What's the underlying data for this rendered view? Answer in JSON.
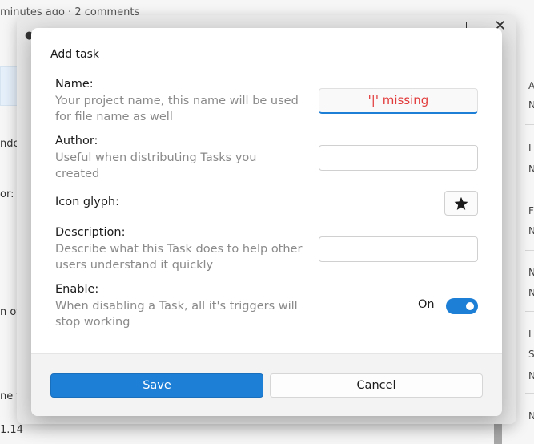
{
  "background": {
    "top_line": "minutes ago · 2 comments",
    "left_snippets": [
      "ndo",
      "or:",
      "n of",
      "ne f",
      "1.14"
    ],
    "right_letters": [
      "A",
      "N",
      "L",
      "N",
      "F",
      "N",
      "N",
      "N",
      "L",
      "S",
      "N",
      "N"
    ],
    "right_panel_letter": "F"
  },
  "dialog": {
    "title": "Add task",
    "fields": {
      "name": {
        "label": "Name:",
        "description": "Your project name, this name will be used for file name as well",
        "error": "'|' missing"
      },
      "author": {
        "label": "Author:",
        "description": "Useful when distributing Tasks you created",
        "value": ""
      },
      "icon": {
        "label": "Icon glyph:",
        "glyph": "★",
        "icon_name": "star-icon"
      },
      "description": {
        "label": "Description:",
        "description": "Describe what this Task does to help other users understand it quickly",
        "value": ""
      },
      "enable": {
        "label": "Enable:",
        "description": "When disabling a Task, all it's triggers will stop working",
        "state_label": "On",
        "on": true
      }
    },
    "buttons": {
      "save": "Save",
      "cancel": "Cancel"
    }
  },
  "colors": {
    "accent": "#1e7fd6",
    "error": "#e23b3b"
  }
}
